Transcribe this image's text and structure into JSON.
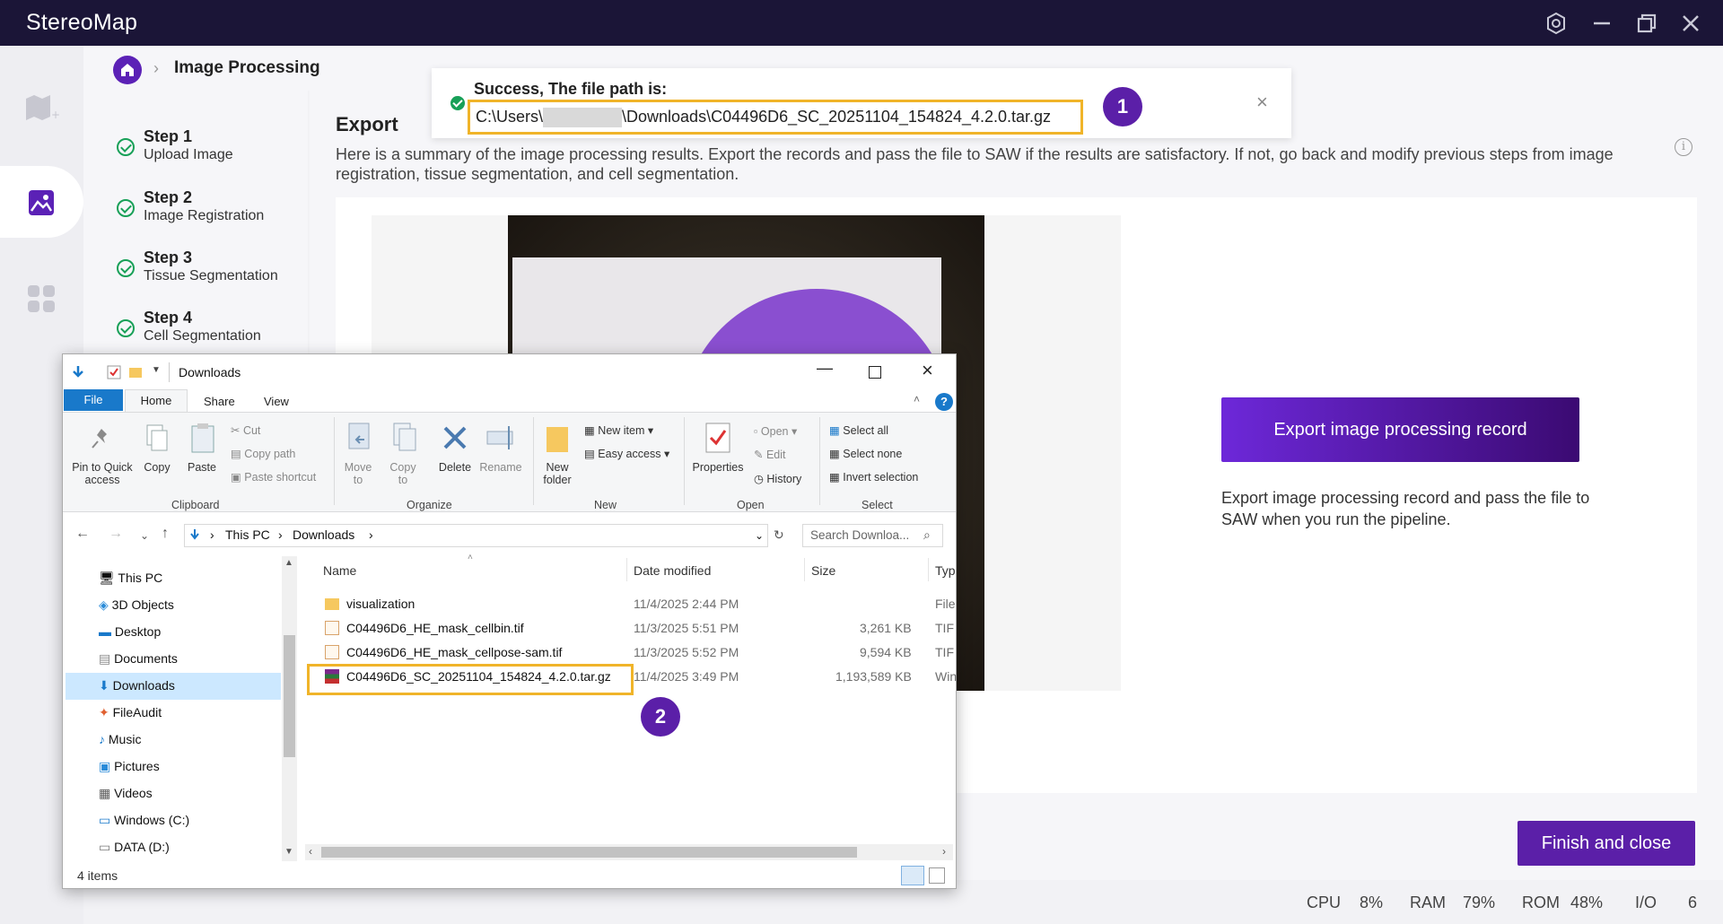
{
  "app": {
    "title": "StereoMap",
    "breadcrumb": {
      "title": "Image Processing"
    },
    "steps": [
      {
        "title": "Step 1",
        "subtitle": "Upload Image"
      },
      {
        "title": "Step 2",
        "subtitle": "Image Registration"
      },
      {
        "title": "Step 3",
        "subtitle": "Tissue Segmentation"
      },
      {
        "title": "Step 4",
        "subtitle": "Cell Segmentation"
      }
    ],
    "export": {
      "title": "Export",
      "description": "Here is a summary of the image processing results. Export the records and pass the file to SAW if the results are satisfactory. If not, go back and modify previous steps from image registration, tissue segmentation, and cell segmentation.",
      "button_label": "Export image processing record",
      "note": "Export image processing record and pass the file to SAW when you run the pipeline."
    },
    "finish_label": "Finish and close",
    "status": [
      {
        "label": "CPU",
        "value": "8%"
      },
      {
        "label": "RAM",
        "value": "79%"
      },
      {
        "label": "ROM",
        "value": "48%"
      },
      {
        "label": "I/O",
        "value": "6"
      }
    ],
    "colors": {
      "accent": "#5b1fa8",
      "titlebar": "#1b1537",
      "success": "#18a058",
      "highlight": "#f0b429"
    }
  },
  "toast": {
    "title": "Success, The file path is:",
    "path_prefix": "C:\\Users\\",
    "path_suffix": "\\Downloads\\C04496D6_SC_20251104_154824_4.2.0.tar.gz",
    "close": "×"
  },
  "badges": [
    "1",
    "2"
  ],
  "explorer": {
    "title": "Downloads",
    "tabs": {
      "file": "File",
      "home": "Home",
      "share": "Share",
      "view": "View"
    },
    "ribbon": {
      "pin": [
        "Pin to Quick",
        "access"
      ],
      "copy": "Copy",
      "paste": "Paste",
      "cut": "Cut",
      "copy_path": "Copy path",
      "paste_shortcut": "Paste shortcut",
      "move_to": [
        "Move",
        "to"
      ],
      "copy_to": [
        "Copy",
        "to"
      ],
      "delete": "Delete",
      "rename": "Rename",
      "new_folder": [
        "New",
        "folder"
      ],
      "new_item": "New item",
      "easy_access": "Easy access",
      "properties": "Properties",
      "open": "Open",
      "edit": "Edit",
      "history": "History",
      "select_all": "Select all",
      "select_none": "Select none",
      "invert_selection": "Invert selection",
      "groups": [
        "Clipboard",
        "Organize",
        "New",
        "Open",
        "Select"
      ]
    },
    "address": {
      "this_pc": "This PC",
      "downloads": "Downloads"
    },
    "search_placeholder": "Search Downloa...",
    "columns": [
      "Name",
      "Date modified",
      "Size",
      "Typ"
    ],
    "nav": [
      "This PC",
      "3D Objects",
      "Desktop",
      "Documents",
      "Downloads",
      "FileAudit",
      "Music",
      "Pictures",
      "Videos",
      "Windows (C:)",
      "DATA (D:)"
    ],
    "files": [
      {
        "name": "visualization",
        "date": "11/4/2025 2:44 PM",
        "size": "",
        "type": "File"
      },
      {
        "name": "C04496D6_HE_mask_cellbin.tif",
        "date": "11/3/2025 5:51 PM",
        "size": "3,261 KB",
        "type": "TIF"
      },
      {
        "name": "C04496D6_HE_mask_cellpose-sam.tif",
        "date": "11/3/2025 5:52 PM",
        "size": "9,594 KB",
        "type": "TIF"
      },
      {
        "name": "C04496D6_SC_20251104_154824_4.2.0.tar.gz",
        "date": "11/4/2025 3:49 PM",
        "size": "1,193,589 KB",
        "type": "Win"
      }
    ],
    "item_count": "4 items"
  }
}
